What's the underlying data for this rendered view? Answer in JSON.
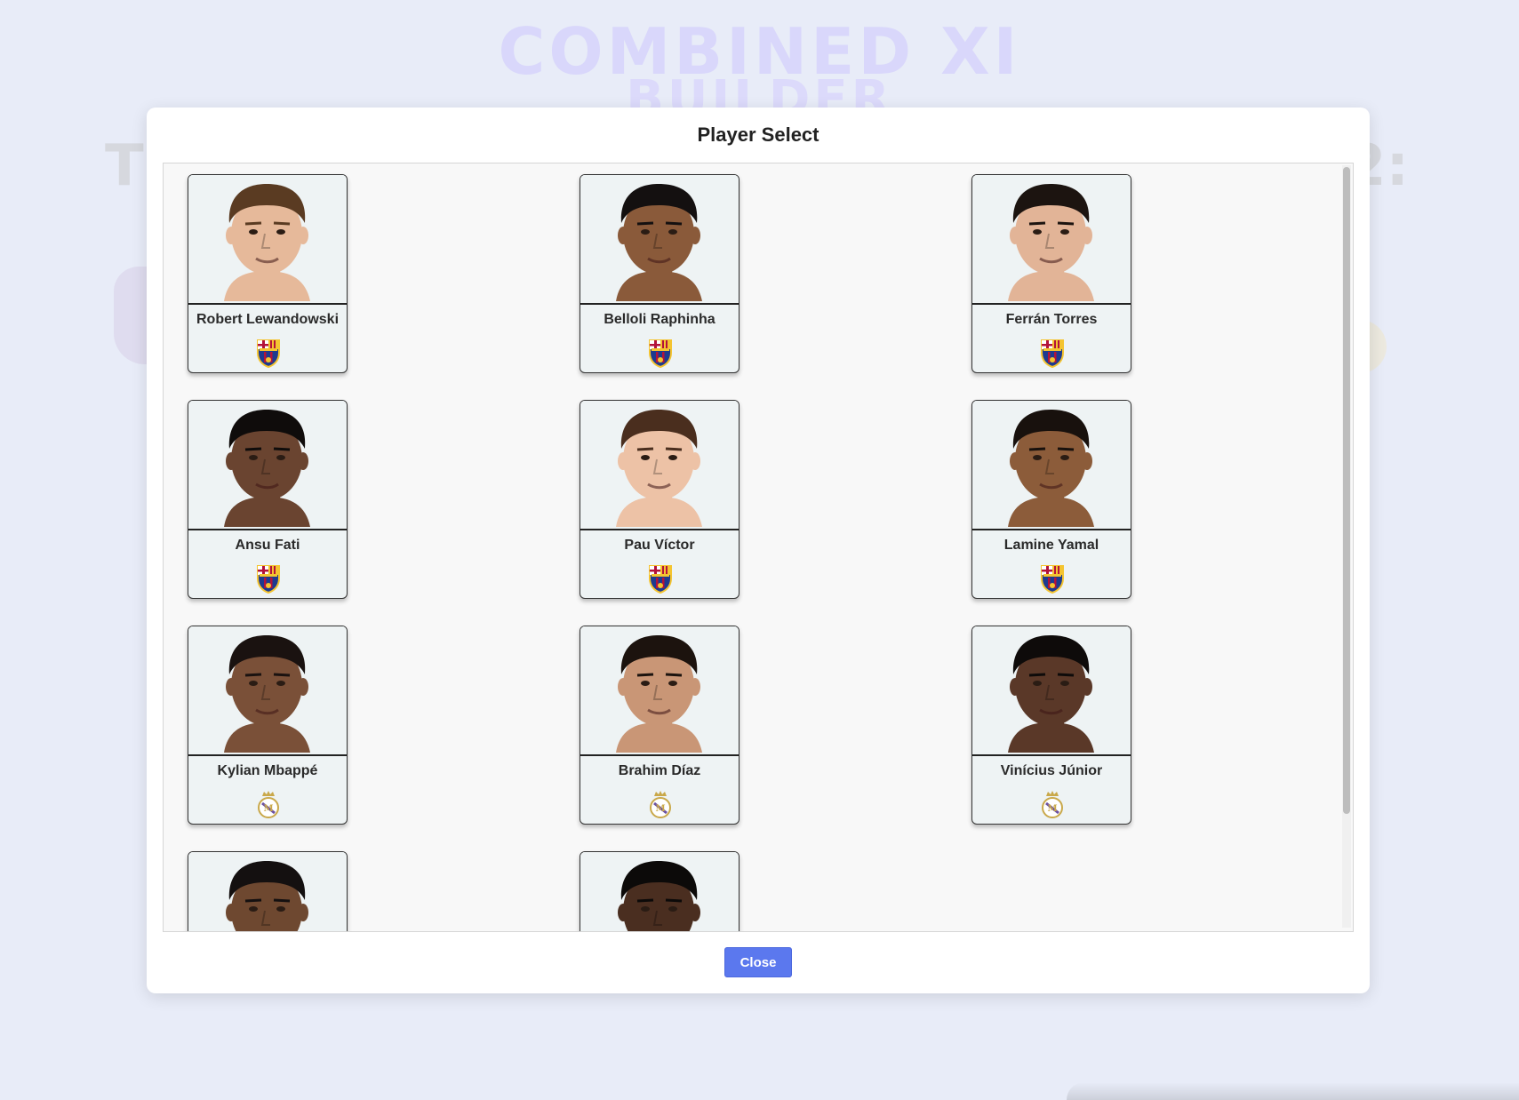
{
  "background": {
    "title": "COMBINED XI",
    "subtitle": "BUILDER",
    "team_left_partial": "TE",
    "team_right_partial": "2:"
  },
  "modal": {
    "title": "Player Select",
    "close_label": "Close"
  },
  "players": [
    {
      "name": "Robert Lewandowski",
      "club": "barcelona",
      "skin": "#e6b99a",
      "hair": "#5a3b22"
    },
    {
      "name": "Belloli Raphinha",
      "club": "barcelona",
      "skin": "#8a5a3a",
      "hair": "#141010"
    },
    {
      "name": "Ferrán Torres",
      "club": "barcelona",
      "skin": "#e2b497",
      "hair": "#1c1410"
    },
    {
      "name": "Ansu Fati",
      "club": "barcelona",
      "skin": "#6a4430",
      "hair": "#0f0c0b"
    },
    {
      "name": "Pau Víctor",
      "club": "barcelona",
      "skin": "#edc2a6",
      "hair": "#4a2e1e"
    },
    {
      "name": "Lamine Yamal",
      "club": "barcelona",
      "skin": "#8c5c3a",
      "hair": "#18110d"
    },
    {
      "name": "Kylian Mbappé",
      "club": "real-madrid",
      "skin": "#7a5038",
      "hair": "#1a1210"
    },
    {
      "name": "Brahim Díaz",
      "club": "real-madrid",
      "skin": "#c99676",
      "hair": "#1c130e"
    },
    {
      "name": "Vinícius Júnior",
      "club": "real-madrid",
      "skin": "#5a3828",
      "hair": "#0e0b0a"
    },
    {
      "name": "",
      "club": "",
      "skin": "#6e4830",
      "hair": "#141010"
    },
    {
      "name": "",
      "club": "",
      "skin": "#4a2e20",
      "hair": "#0c0a09"
    }
  ],
  "colors": {
    "accent": "#5b78ee",
    "barca_blue": "#1d3a8f",
    "barca_red": "#b3123a",
    "barca_yellow": "#f4c430",
    "madrid_gold": "#c9a84a"
  }
}
